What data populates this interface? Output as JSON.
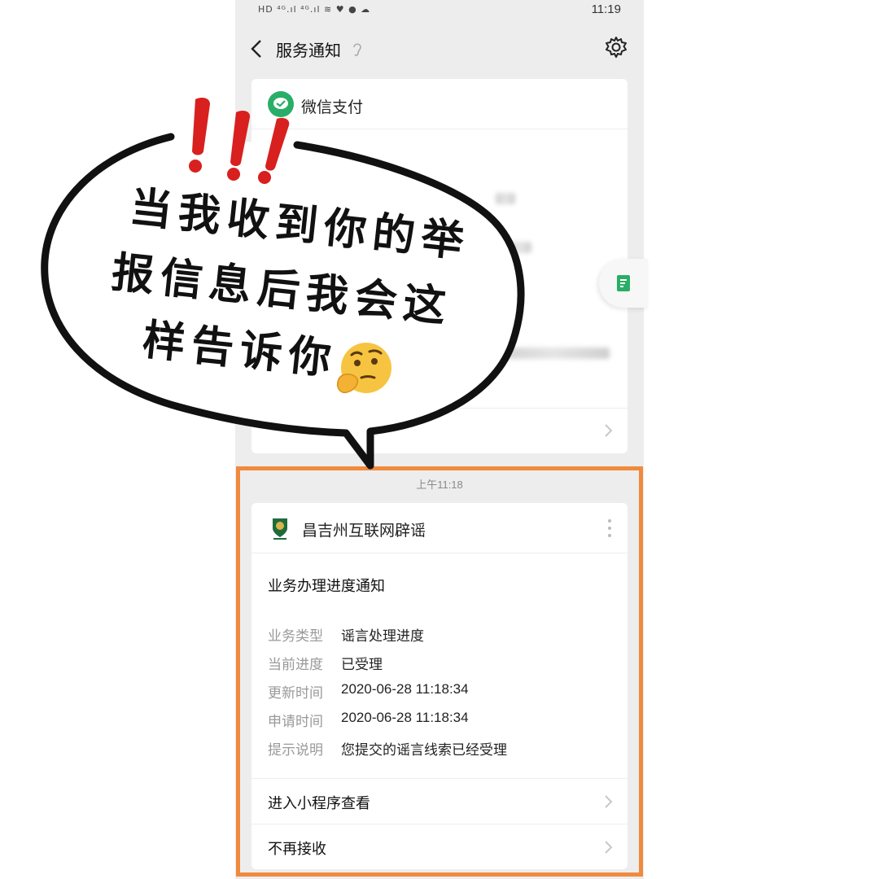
{
  "status_bar": {
    "time": "11:19"
  },
  "nav": {
    "title": "服务通知"
  },
  "card1": {
    "app_name": "微信支付"
  },
  "timestamp": "上午11:18",
  "card2": {
    "org_name": "昌吉州互联网辟谣",
    "title": "业务办理进度通知",
    "fields": [
      {
        "label": "业务类型",
        "value": "谣言处理进度"
      },
      {
        "label": "当前进度",
        "value": "已受理"
      },
      {
        "label": "更新时间",
        "value": "2020-06-28 11:18:34"
      },
      {
        "label": "申请时间",
        "value": "2020-06-28 11:18:34"
      },
      {
        "label": "提示说明",
        "value": "您提交的谣言线索已经受理"
      }
    ],
    "link_open": "进入小程序查看",
    "link_unsubscribe": "不再接收"
  },
  "bubble": {
    "line1": "当我收到你的举",
    "line2": "报信息后我会这",
    "line3": "样告诉你"
  },
  "colors": {
    "highlight_border": "#f08a3c",
    "wechat_green": "#2aae67",
    "exclaim_red": "#d8201f"
  },
  "icons": [
    "back-icon",
    "ear-icon",
    "gear-icon",
    "wechat-pay-icon",
    "more-icon",
    "chevron-right-icon",
    "thinking-face-emoji"
  ]
}
